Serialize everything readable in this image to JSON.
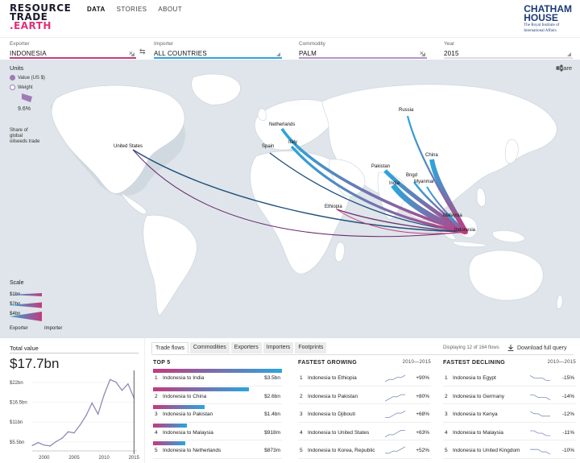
{
  "header": {
    "logo_line1": "RESOURCE",
    "logo_line2": "TRADE",
    "logo_line3": ".EARTH",
    "nav": [
      {
        "label": "DATA",
        "active": true
      },
      {
        "label": "STORIES",
        "active": false
      },
      {
        "label": "ABOUT",
        "active": false
      }
    ],
    "partner_line1": "CHATHAM",
    "partner_line2": "HOUSE",
    "partner_sub1": "The Royal Institute of",
    "partner_sub2": "International Affairs"
  },
  "filters": {
    "exporter_label": "Exporter",
    "exporter_value": "INDONESIA",
    "importer_label": "Importer",
    "importer_value": "ALL COUNTRIES",
    "commodity_label": "Commodity",
    "commodity_value": "PALM",
    "year_label": "Year",
    "year_value": "2015",
    "colors": {
      "exporter": "#c23b7e",
      "importer": "#2aa6dc",
      "commodity": "#b495c8",
      "year": "#ddd"
    }
  },
  "map": {
    "units_label": "Units",
    "unit_options": [
      {
        "label": "Value (US $)",
        "selected": true
      },
      {
        "label": "Weight",
        "selected": false
      }
    ],
    "share_pct": "9.6%",
    "share_caption": [
      "Share of",
      "global",
      "oilseeds trade"
    ],
    "share_button": "Share",
    "countries": [
      "Russia",
      "Netherlands",
      "United States",
      "Spain",
      "Italy",
      "China",
      "Pakistan",
      "Bngd",
      "India",
      "Myanmar",
      "Ethiopia",
      "Malaysia",
      "Indonesia"
    ],
    "scale_label": "Scale",
    "scale_items": [
      "$1bn",
      "$2bn",
      "$4bn"
    ],
    "exporter_caption": "Exporter",
    "importer_caption": "Importer",
    "colors": {
      "ocean": "#dfe5ea",
      "land": "#ffffff",
      "exporter": "#c23b7e",
      "importer": "#2aa6dc",
      "low_flow": "#1d4e7a"
    }
  },
  "total": {
    "label": "Total value",
    "value": "$17.7bn",
    "y_ticks": [
      "$22bn",
      "$16.5bn",
      "$11bn",
      "$5.5bn"
    ],
    "x_ticks": [
      "2000",
      "2005",
      "2010",
      "2015"
    ]
  },
  "chart_data": {
    "type": "line",
    "title": "Total value",
    "x": [
      1998,
      1999,
      2000,
      2001,
      2002,
      2003,
      2004,
      2005,
      2006,
      2007,
      2008,
      2009,
      2010,
      2011,
      2012,
      2013,
      2014,
      2015
    ],
    "y": [
      4.5,
      5.3,
      4.6,
      4.4,
      5.6,
      6.5,
      8.3,
      8.0,
      10.2,
      12.8,
      16.3,
      13.2,
      18.5,
      22.8,
      22.1,
      19.8,
      21.6,
      17.7
    ],
    "ylim": [
      3,
      24
    ],
    "yticks": [
      "$5.5bn",
      "$11bn",
      "$16.5bn",
      "$22bn"
    ],
    "xticks": [
      "2000",
      "2005",
      "2010",
      "2015"
    ]
  },
  "tabs": [
    "Trade flows",
    "Commodities",
    "Exporters",
    "Importers",
    "Footprints"
  ],
  "active_tab": "Trade flows",
  "flow_count": "Displaying 12 of 164 flows",
  "download_label": "Download full query",
  "top5": {
    "heading": "TOP 5",
    "rows": [
      {
        "num": "1",
        "name": "Indonesia to India",
        "value": "$3.5bn",
        "amount": 3.5
      },
      {
        "num": "2",
        "name": "Indonesia to China",
        "value": "$2.6bn",
        "amount": 2.6
      },
      {
        "num": "3",
        "name": "Indonesia to Pakistan",
        "value": "$1.4bn",
        "amount": 1.4
      },
      {
        "num": "4",
        "name": "Indonesia to Malaysia",
        "value": "$918m",
        "amount": 0.918
      },
      {
        "num": "5",
        "name": "Indonesia to Netherlands",
        "value": "$873m",
        "amount": 0.873
      }
    ]
  },
  "growing": {
    "heading": "FASTEST GROWING",
    "years": "2010—2015",
    "rows": [
      {
        "num": "1",
        "name": "Indonesia to Ethiopia",
        "value": "+90%"
      },
      {
        "num": "2",
        "name": "Indonesia to Pakistan",
        "value": "+80%"
      },
      {
        "num": "3",
        "name": "Indonesia to Djibouti",
        "value": "+68%"
      },
      {
        "num": "4",
        "name": "Indonesia to United States",
        "value": "+63%"
      },
      {
        "num": "5",
        "name": "Indonesia to Korea, Republic",
        "value": "+52%"
      }
    ]
  },
  "declining": {
    "heading": "FASTEST DECLINING",
    "years": "2010—2015",
    "rows": [
      {
        "num": "1",
        "name": "Indonesia to Egypt",
        "value": "-15%"
      },
      {
        "num": "2",
        "name": "Indonesia to Germany",
        "value": "-14%"
      },
      {
        "num": "3",
        "name": "Indonesia to Kenya",
        "value": "-12%"
      },
      {
        "num": "4",
        "name": "Indonesia to Malaysia",
        "value": "-11%"
      },
      {
        "num": "5",
        "name": "Indonesia to United Kingdom",
        "value": "-10%"
      }
    ]
  }
}
